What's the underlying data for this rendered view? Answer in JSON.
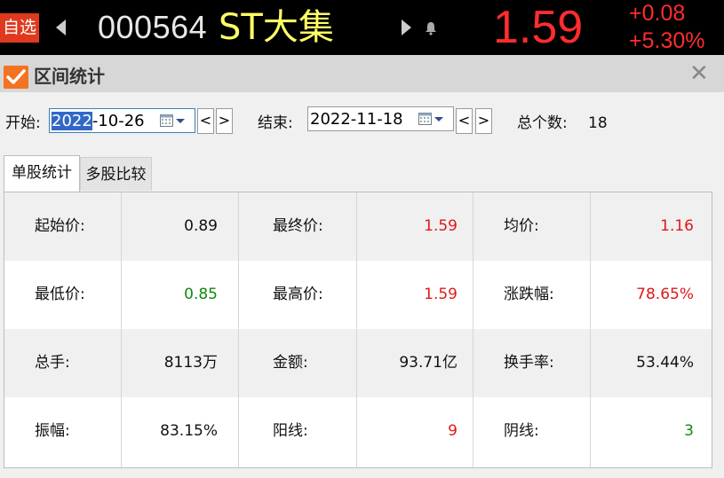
{
  "header": {
    "fav_label": "自选",
    "code": "000564",
    "name": "ST大集",
    "price": "1.59",
    "change": "+0.08",
    "change_pct": "+5.30%"
  },
  "dialog": {
    "title": "区间统计",
    "close_glyph": "✕"
  },
  "range": {
    "start_label": "开始:",
    "start_year": "2022",
    "start_rest": "-10-26",
    "end_label": "结束:",
    "end_value": "2022-11-18",
    "prev_glyph": "<",
    "next_glyph": ">",
    "count_label": "总个数:",
    "count_value": "18"
  },
  "tabs": [
    "单股统计",
    "多股比较"
  ],
  "stats": [
    [
      {
        "label": "起始价:",
        "value": "0.89",
        "color": "black"
      },
      {
        "label": "最终价:",
        "value": "1.59",
        "color": "red"
      },
      {
        "label": "均价:",
        "value": "1.16",
        "color": "red"
      }
    ],
    [
      {
        "label": "最低价:",
        "value": "0.85",
        "color": "green"
      },
      {
        "label": "最高价:",
        "value": "1.59",
        "color": "red"
      },
      {
        "label": "涨跌幅:",
        "value": "78.65%",
        "color": "red"
      }
    ],
    [
      {
        "label": "总手:",
        "value": "8113万",
        "color": "black"
      },
      {
        "label": "金额:",
        "value": "93.71亿",
        "color": "black"
      },
      {
        "label": "换手率:",
        "value": "53.44%",
        "color": "black"
      }
    ],
    [
      {
        "label": "振幅:",
        "value": "83.15%",
        "color": "black"
      },
      {
        "label": "阳线:",
        "value": "9",
        "color": "red"
      },
      {
        "label": "阴线:",
        "value": "3",
        "color": "green"
      }
    ]
  ],
  "colors": {
    "up": "#e01818",
    "down": "#0f8a0f",
    "accent": "#f27422"
  }
}
